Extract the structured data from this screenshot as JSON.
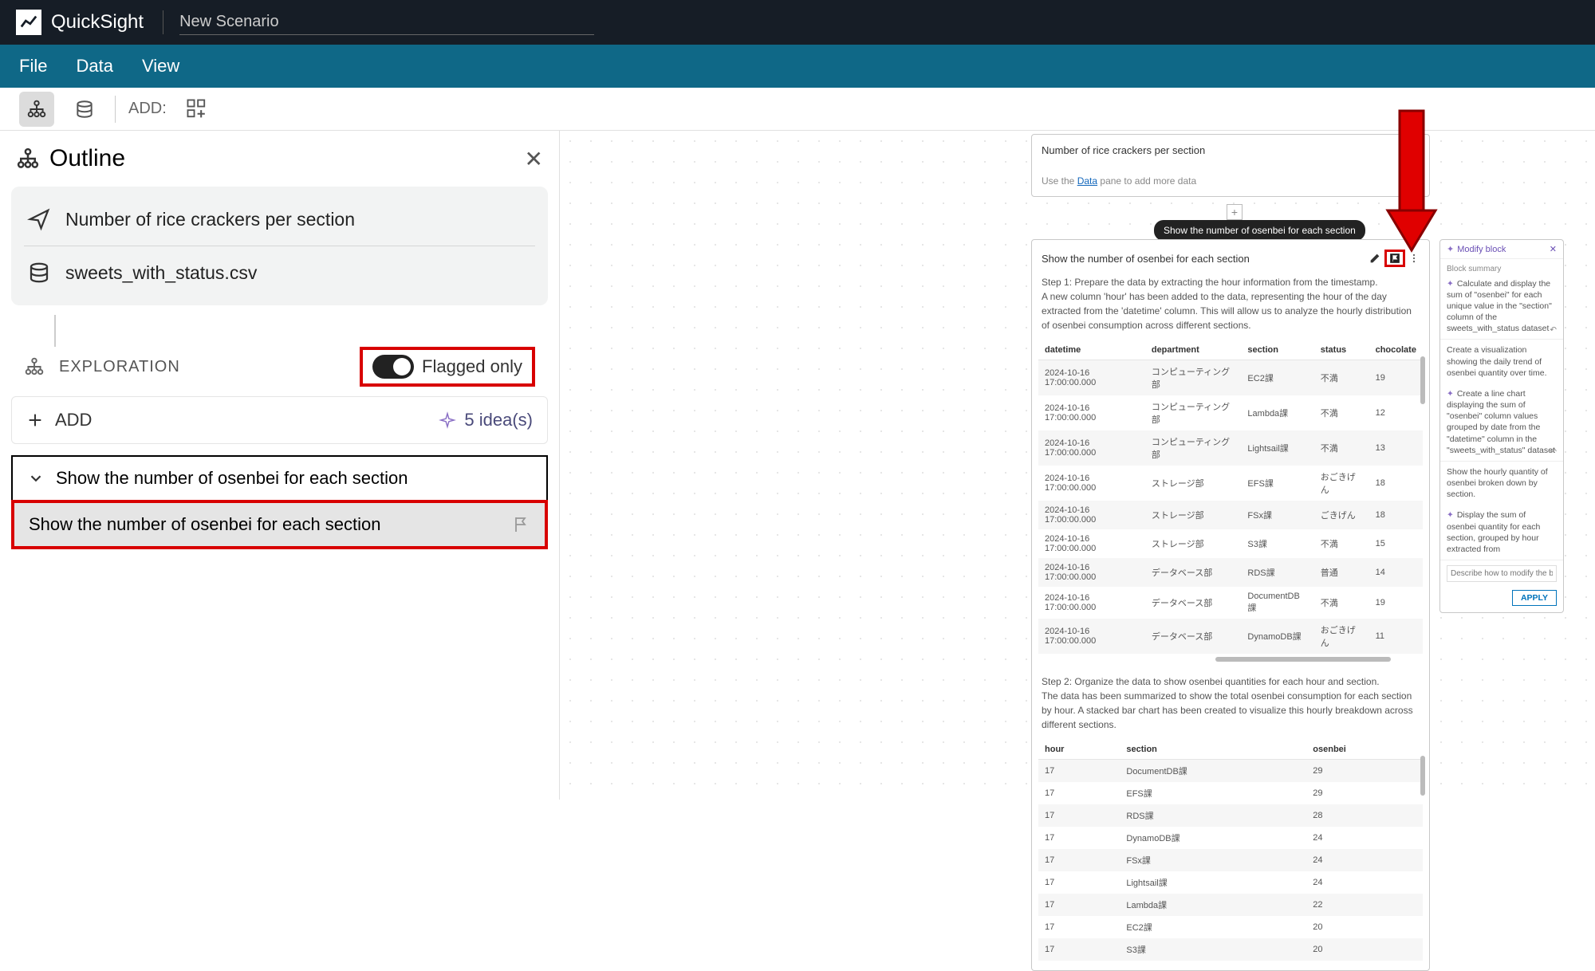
{
  "header": {
    "brand": "QuickSight",
    "scenario_name": "New Scenario"
  },
  "menu": {
    "file": "File",
    "data": "Data",
    "view": "View"
  },
  "toolbar": {
    "add_label": "ADD:"
  },
  "outline": {
    "title": "Outline",
    "thread_title": "Number of rice crackers per section",
    "dataset": "sweets_with_status.csv",
    "exploration_label": "EXPLORATION",
    "flagged_only": "Flagged only",
    "add_label": "ADD",
    "ideas": "5 idea(s)",
    "tree_parent": "Show the number of osenbei for each section",
    "tree_child": "Show the number of osenbei for each section"
  },
  "canvas": {
    "block1_title": "Number of rice crackers per section",
    "block1_hint_prefix": "Use the ",
    "block1_hint_link": "Data",
    "block1_hint_suffix": " pane to add more data",
    "tooltip": "Show the number of osenbei for each section",
    "block2_title": "Show the number of osenbei for each section",
    "step1_l1": "Step 1: Prepare the data by extracting the hour information from the timestamp.",
    "step1_l2": "A new column 'hour' has been added to the data, representing the hour of the day extracted from the 'datetime' column. This will allow us to analyze the hourly distribution of osenbei consumption across different sections.",
    "step2_l1": "Step 2: Organize the data to show osenbei quantities for each hour and section.",
    "step2_l2": "The data has been summarized to show the total osenbei consumption for each section by hour. A stacked bar chart has been created to visualize this hourly breakdown across different sections.",
    "table1": {
      "headers": [
        "datetime",
        "department",
        "section",
        "status",
        "chocolate"
      ],
      "rows": [
        [
          "2024-10-16 17:00:00.000",
          "コンピューティング部",
          "EC2課",
          "不満",
          "19"
        ],
        [
          "2024-10-16 17:00:00.000",
          "コンピューティング部",
          "Lambda課",
          "不満",
          "12"
        ],
        [
          "2024-10-16 17:00:00.000",
          "コンピューティング部",
          "Lightsail課",
          "不満",
          "13"
        ],
        [
          "2024-10-16 17:00:00.000",
          "ストレージ部",
          "EFS課",
          "おごきげん",
          "18"
        ],
        [
          "2024-10-16 17:00:00.000",
          "ストレージ部",
          "FSx課",
          "ごきげん",
          "18"
        ],
        [
          "2024-10-16 17:00:00.000",
          "ストレージ部",
          "S3課",
          "不満",
          "15"
        ],
        [
          "2024-10-16 17:00:00.000",
          "データベース部",
          "RDS課",
          "普通",
          "14"
        ],
        [
          "2024-10-16 17:00:00.000",
          "データベース部",
          "DocumentDB課",
          "不満",
          "19"
        ],
        [
          "2024-10-16 17:00:00.000",
          "データベース部",
          "DynamoDB課",
          "おごきげん",
          "11"
        ]
      ]
    },
    "table2": {
      "headers": [
        "hour",
        "section",
        "osenbei"
      ],
      "rows": [
        [
          "17",
          "DocumentDB課",
          "29"
        ],
        [
          "17",
          "EFS課",
          "29"
        ],
        [
          "17",
          "RDS課",
          "28"
        ],
        [
          "17",
          "DynamoDB課",
          "24"
        ],
        [
          "17",
          "FSx課",
          "24"
        ],
        [
          "17",
          "Lightsail課",
          "24"
        ],
        [
          "17",
          "Lambda課",
          "22"
        ],
        [
          "17",
          "EC2課",
          "20"
        ],
        [
          "17",
          "S3課",
          "20"
        ]
      ]
    }
  },
  "modify": {
    "title": "Modify block",
    "summary_label": "Block summary",
    "summary_text": "Calculate and display the sum of \"osenbei\" for each unique value in the \"section\" column of the sweets_with_status dataset",
    "sugg1": "Create a visualization showing the daily trend of osenbei quantity over time.",
    "sugg2": "Create a line chart displaying the sum of \"osenbei\" column values grouped by date from the \"datetime\" column in the \"sweets_with_status\" dataset",
    "sugg3": "Show the hourly quantity of osenbei broken down by section.",
    "sugg4": "Display the sum of osenbei quantity for each section, grouped by hour extracted from",
    "placeholder": "Describe how to modify the block",
    "apply": "APPLY"
  }
}
